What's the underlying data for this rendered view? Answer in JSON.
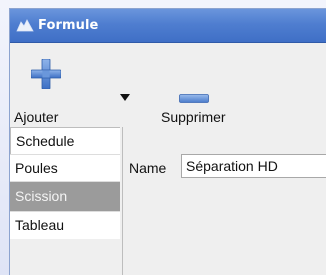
{
  "window": {
    "title": "Formule",
    "title_icon": "app-icon"
  },
  "toolbar": {
    "add_label": "Ajouter",
    "add_icon": "plus-icon",
    "dropdown_icon": "dropdown-arrow-icon",
    "remove_label": "Supprimer",
    "remove_icon": "minus-icon"
  },
  "sidebar": {
    "items": [
      {
        "label": "Schedule",
        "state": "tab-selected"
      },
      {
        "label": "Poules",
        "state": "normal"
      },
      {
        "label": "Scission",
        "state": "active"
      },
      {
        "label": "Tableau",
        "state": "normal"
      }
    ]
  },
  "form": {
    "name_label": "Name",
    "name_value": "Séparation HD"
  },
  "colors": {
    "titlebar": "#4f7ed0",
    "accent_blue": "#3f74c9",
    "active_item": "#9b9b9b"
  }
}
